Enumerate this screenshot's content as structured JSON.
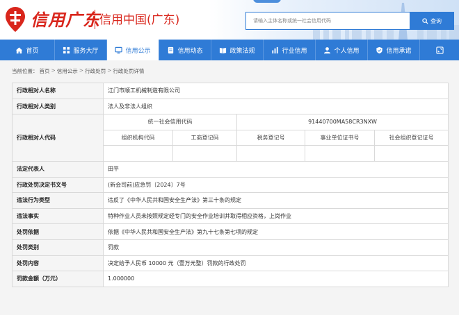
{
  "header": {
    "logo_script": "信用广东",
    "logo_sub": "信用中国(广东)",
    "search_placeholder": "请输入主体名称或统一社会信用代码",
    "search_button": "查询"
  },
  "nav": {
    "items": [
      {
        "label": "首页",
        "icon": "home-icon"
      },
      {
        "label": "服务大厅",
        "icon": "grid-icon"
      },
      {
        "label": "信用公示",
        "icon": "monitor-icon",
        "active": true
      },
      {
        "label": "信用动态",
        "icon": "document-icon"
      },
      {
        "label": "政策法规",
        "icon": "book-icon"
      },
      {
        "label": "行业信用",
        "icon": "chart-icon"
      },
      {
        "label": "个人信用",
        "icon": "user-icon"
      },
      {
        "label": "信用承诺",
        "icon": "shield-icon"
      },
      {
        "label": "",
        "icon": "expand-icon"
      }
    ]
  },
  "breadcrumb": {
    "prefix": "当前位置：",
    "items": [
      "首页",
      "信用公示",
      "行政处罚",
      "行政处罚详情"
    ],
    "sep": ">"
  },
  "detail": {
    "name_label": "行政相对人名称",
    "name_value": "江门市顺工机械制造有限公司",
    "type_label": "行政相对人类别",
    "type_value": "法人及非法人组织",
    "code_label": "行政相对人代码",
    "uscc_label": "统一社会信用代码",
    "uscc_value": "91440700MA58CR3NXW",
    "sub_headers": [
      "组织机构代码",
      "工商登记码",
      "税务登记号",
      "事业单位证书号",
      "社会组织登记证号"
    ],
    "sub_values": [
      "",
      "",
      "",
      "",
      ""
    ],
    "legal_rep_label": "法定代表人",
    "legal_rep_value": "田平",
    "doc_no_label": "行政处罚决定书文号",
    "doc_no_value": "(新会司前)应急罚〔2024〕7号",
    "violation_type_label": "违法行为类型",
    "violation_type_value": "违反了《中华人民共和国安全生产法》第三十条的规定",
    "facts_label": "违法事实",
    "facts_value": "特种作业人员未按照规定经专门的安全作业培训并取得相应资格，上岗作业",
    "basis_label": "处罚依据",
    "basis_value": "依据《中华人民共和国安全生产法》第九十七条第七项的规定",
    "category_label": "处罚类别",
    "category_value": "罚款",
    "content_label": "处罚内容",
    "content_value": "决定给予人民币 10000 元（壹万元整）罚款的行政处罚",
    "amount_label": "罚款金额（万元）",
    "amount_value": "1.000000"
  },
  "colors": {
    "brand_red": "#d9261c",
    "nav_blue": "#2f7bd6"
  }
}
